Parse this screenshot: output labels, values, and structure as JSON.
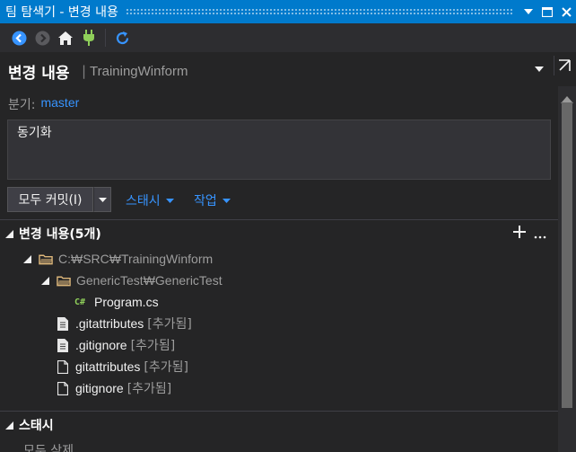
{
  "window": {
    "title": "팀 탐색기 - 변경 내용"
  },
  "toolbar": {
    "buttons": [
      "back-icon",
      "forward-icon",
      "home-icon",
      "connect-icon",
      "refresh-icon"
    ]
  },
  "header": {
    "title": "변경 내용",
    "separator": "|",
    "repo": "TrainingWinform"
  },
  "branch": {
    "label": "분기:",
    "value": "master"
  },
  "commit_message": {
    "value": "동기화"
  },
  "actions": {
    "commit_all": "모두 커밋(I)",
    "stash": "스태시",
    "actions": "작업"
  },
  "changes": {
    "header": "변경 내용(5개)",
    "add_icon": "plus-icon",
    "more_icon": "ellipsis-icon",
    "tree": {
      "root_path": "C:₩SRC₩TrainingWinform",
      "sub_path": "GenericTest₩GenericTest",
      "sub_files": [
        {
          "name": "Program.cs",
          "status": ""
        }
      ],
      "files": [
        {
          "name": ".gitattributes",
          "status": "[추가됨]"
        },
        {
          "name": ".gitignore",
          "status": "[추가됨]"
        },
        {
          "name": "gitattributes",
          "status": "[추가됨]"
        },
        {
          "name": "gitignore",
          "status": "[추가됨]"
        }
      ]
    }
  },
  "stash_section": {
    "header": "스태시",
    "delete_all": "모두 삭제"
  },
  "colors": {
    "accent": "#007acc",
    "link": "#3794ff",
    "background": "#252526"
  }
}
